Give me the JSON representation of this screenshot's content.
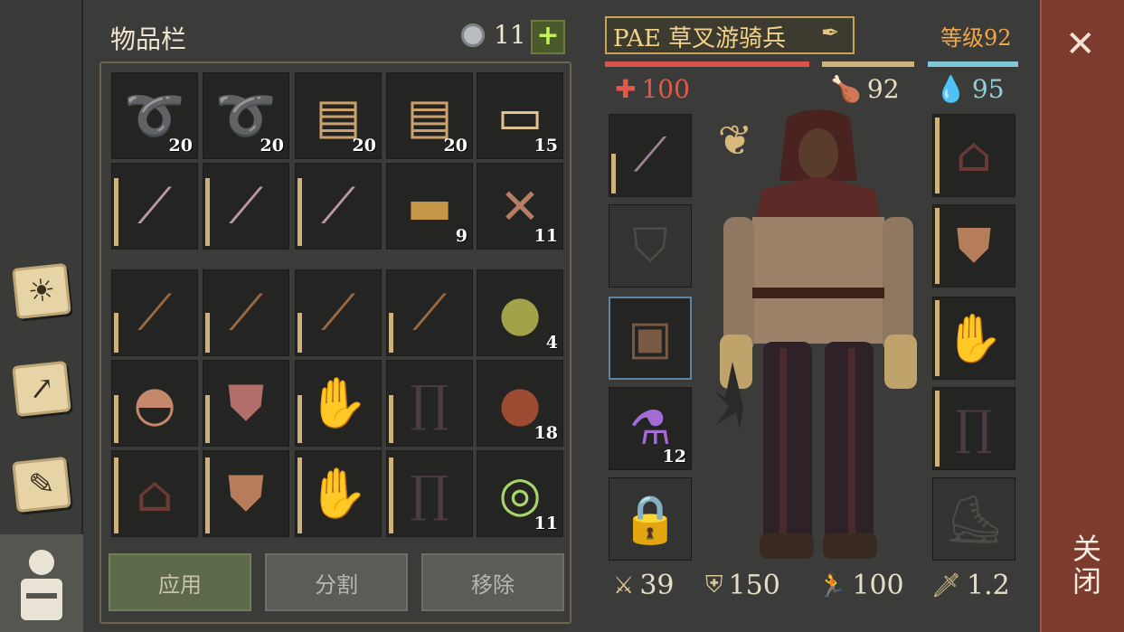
{
  "inventory": {
    "title": "物品栏",
    "currency_icon": "gem-icon",
    "currency_count": "11",
    "add_label": "+",
    "slots": [
      {
        "icon": "rope-icon",
        "qty": "20",
        "durability": null
      },
      {
        "icon": "rope-icon",
        "qty": "20",
        "durability": null
      },
      {
        "icon": "cloth-icon",
        "qty": "20",
        "durability": null
      },
      {
        "icon": "cloth-icon",
        "qty": "20",
        "durability": null
      },
      {
        "icon": "linen-icon",
        "qty": "15",
        "durability": null
      },
      {
        "icon": "sword-icon",
        "qty": "",
        "durability": 0.85
      },
      {
        "icon": "sword-icon",
        "qty": "",
        "durability": 0.85
      },
      {
        "icon": "sword-icon",
        "qty": "",
        "durability": 0.85
      },
      {
        "icon": "ingot-icon",
        "qty": "9",
        "durability": null
      },
      {
        "icon": "nails-icon",
        "qty": "11",
        "durability": null
      },
      {
        "icon": "spiked-club-icon",
        "qty": "",
        "durability": 0.5
      },
      {
        "icon": "spiked-club-icon",
        "qty": "",
        "durability": 0.5
      },
      {
        "icon": "spiked-club-icon",
        "qty": "",
        "durability": 0.5
      },
      {
        "icon": "spiked-club-icon",
        "qty": "",
        "durability": 0.5
      },
      {
        "icon": "herb-ball-icon",
        "qty": "4",
        "durability": null
      },
      {
        "icon": "helmet-icon",
        "qty": "",
        "durability": 0.6
      },
      {
        "icon": "chainmail-icon",
        "qty": "",
        "durability": 0.6
      },
      {
        "icon": "chain-gloves-icon",
        "qty": "",
        "durability": 0.6
      },
      {
        "icon": "pants-icon",
        "qty": "",
        "durability": 0.6
      },
      {
        "icon": "flask-icon",
        "qty": "18",
        "durability": null
      },
      {
        "icon": "hood-icon",
        "qty": "",
        "durability": 0.95
      },
      {
        "icon": "gambeson-icon",
        "qty": "",
        "durability": 0.95
      },
      {
        "icon": "leather-gloves-icon",
        "qty": "",
        "durability": 0.95
      },
      {
        "icon": "pants-icon",
        "qty": "",
        "durability": 0.95
      },
      {
        "icon": "cooked-food-icon",
        "qty": "11",
        "durability": null
      }
    ],
    "buttons": {
      "apply": "应用",
      "split": "分割",
      "remove": "移除"
    }
  },
  "character": {
    "name": "PAE 草叉游骑兵",
    "level": "等级92",
    "health": "100",
    "hunger": "92",
    "thirst": "95",
    "colors": {
      "health": "#d9534a",
      "hunger": "#cfb27a",
      "thirst": "#7fc7d6"
    },
    "left_slots": [
      {
        "icon": "mace-icon",
        "qty": "",
        "durability": 0.5
      },
      {
        "icon": "shield-icon",
        "qty": "",
        "empty": true
      },
      {
        "icon": "backpack-icon",
        "qty": "",
        "selected": true
      },
      {
        "icon": "potion-icon",
        "qty": "12"
      },
      {
        "icon": "lock-icon",
        "qty": "",
        "empty": true
      }
    ],
    "right_slots": [
      {
        "icon": "hood-icon",
        "qty": "",
        "durability": 0.95
      },
      {
        "icon": "gambeson-icon",
        "qty": "",
        "durability": 0.95
      },
      {
        "icon": "leather-gloves-icon",
        "qty": "",
        "durability": 0.95
      },
      {
        "icon": "pants-icon",
        "qty": "",
        "durability": 0.95
      },
      {
        "icon": "boots-icon",
        "qty": "",
        "empty": true
      }
    ],
    "stats": {
      "attack": "39",
      "defense": "150",
      "speed": "100",
      "attack_speed": "1.2"
    }
  },
  "close": {
    "label": "关闭"
  }
}
